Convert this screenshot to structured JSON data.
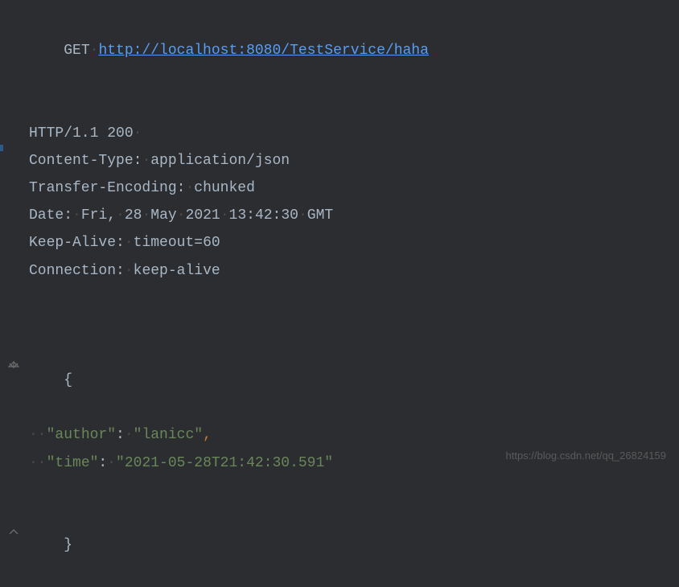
{
  "request": {
    "method": "GET",
    "url": "http://localhost:8080/TestService/haha"
  },
  "response": {
    "status_line": "HTTP/1.1 200",
    "headers": [
      {
        "name": "Content-Type",
        "value": "application/json"
      },
      {
        "name": "Transfer-Encoding",
        "value": "chunked"
      },
      {
        "name": "Date",
        "value": "Fri, 28 May 2021 13:42:30 GMT"
      },
      {
        "name": "Keep-Alive",
        "value": "timeout=60"
      },
      {
        "name": "Connection",
        "value": "keep-alive"
      }
    ]
  },
  "json_body": {
    "open_brace": "{",
    "close_brace": "}",
    "entries": [
      {
        "key": "\"author\"",
        "value": "\"lanicc\"",
        "trailing_comma": ","
      },
      {
        "key": "\"time\"",
        "value": "\"2021-05-28T21:42:30.591\"",
        "trailing_comma": ""
      }
    ]
  },
  "watermark": {
    "text": "https://blog.csdn.net/qq_26824159"
  }
}
